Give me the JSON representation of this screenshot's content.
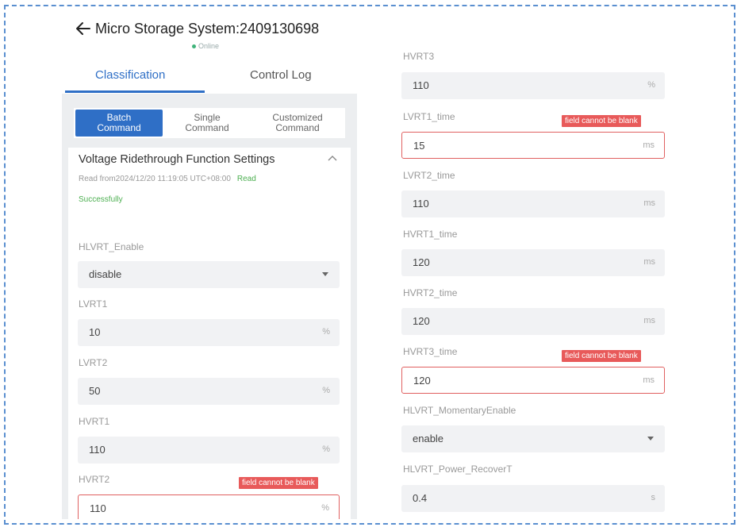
{
  "header": {
    "title": "Micro Storage System:2409130698",
    "status": "Online"
  },
  "tabs": [
    {
      "label": "Classification"
    },
    {
      "label": "Control Log"
    }
  ],
  "commands": [
    {
      "label": "Batch Command"
    },
    {
      "label": "Single Command"
    },
    {
      "label": "Customized Command"
    }
  ],
  "section": {
    "title": "Voltage Ridethrough Function Settings",
    "read_info": "Read from2024/12/20 11:19:05 UTC+08:00",
    "read_status_1": "Read",
    "read_status_2": "Successfully"
  },
  "error_text": "field cannot be blank",
  "left_fields": [
    {
      "label": "HLVRT_Enable",
      "value": "disable",
      "unit": "",
      "type": "select",
      "error": false
    },
    {
      "label": "LVRT1",
      "value": "10",
      "unit": "%",
      "type": "input",
      "error": false
    },
    {
      "label": "LVRT2",
      "value": "50",
      "unit": "%",
      "type": "input",
      "error": false
    },
    {
      "label": "HVRT1",
      "value": "110",
      "unit": "%",
      "type": "input",
      "error": false
    },
    {
      "label": "HVRT2",
      "value": "110",
      "unit": "%",
      "type": "input",
      "error": true
    }
  ],
  "right_fields": [
    {
      "label": "HVRT3",
      "value": "110",
      "unit": "%",
      "type": "input",
      "error": false
    },
    {
      "label": "LVRT1_time",
      "value": "15",
      "unit": "ms",
      "type": "input",
      "error": true
    },
    {
      "label": "LVRT2_time",
      "value": "110",
      "unit": "ms",
      "type": "input",
      "error": false
    },
    {
      "label": "HVRT1_time",
      "value": "120",
      "unit": "ms",
      "type": "input",
      "error": false
    },
    {
      "label": "HVRT2_time",
      "value": "120",
      "unit": "ms",
      "type": "input",
      "error": false
    },
    {
      "label": "HVRT3_time",
      "value": "120",
      "unit": "ms",
      "type": "input",
      "error": true
    },
    {
      "label": "HLVRT_MomentaryEnable",
      "value": "enable",
      "unit": "",
      "type": "select",
      "error": false
    },
    {
      "label": "HLVRT_Power_RecoverT",
      "value": "0.4",
      "unit": "s",
      "type": "input",
      "error": false
    }
  ],
  "colors": {
    "accent": "#2f6fc6",
    "error": "#e85a5a",
    "success": "#4caf50",
    "frame": "#5a8fd0"
  }
}
